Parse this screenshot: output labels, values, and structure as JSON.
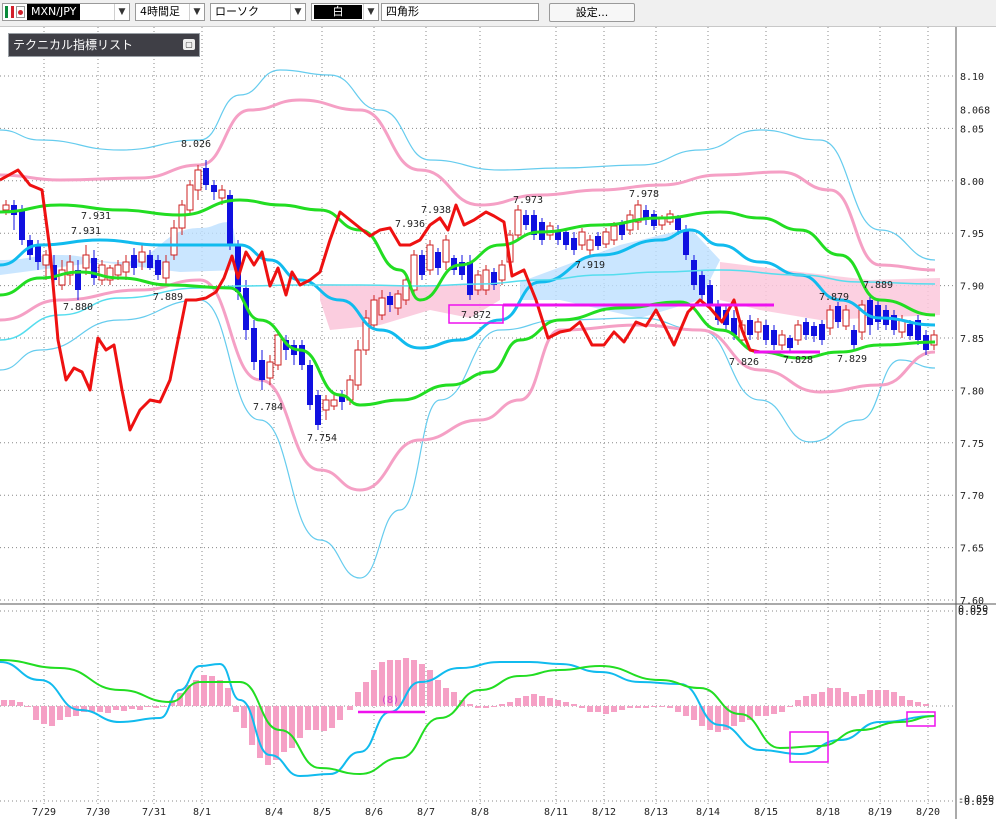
{
  "toolbar": {
    "pair": "MXN/JPY",
    "timeframe": "4時間足",
    "chart_style": "ローソク",
    "color": "白",
    "shape": "四角形",
    "settings": "設定..."
  },
  "indicator_panel": {
    "label": "テクニカル指標リスト"
  },
  "icons": {
    "dropdown": "chevron-down-icon",
    "panel": "window-toggle-icon",
    "flags": [
      "mexico-flag-icon",
      "japan-flag-icon"
    ]
  },
  "colors": {
    "bull": "#cc2222",
    "bear": "#1010e0",
    "rsi_line": "#ee1111",
    "ma_green": "#22dd22",
    "ma_cyan": "#11bbee",
    "bb_pink": "#f5a0c5",
    "bb_outer": "#66ccee",
    "marker": "#ee11ee",
    "cloud_pos": "#bde0ff",
    "cloud_neg": "#fbc8dc"
  },
  "chart_data": {
    "type": "candlestick",
    "ylim": [
      7.6,
      8.1
    ],
    "y_ticks": [
      "8.10",
      "8.068",
      "8.05",
      "8.00",
      "7.95",
      "7.90",
      "7.85",
      "7.80",
      "7.75",
      "7.70",
      "7.65",
      "7.60"
    ],
    "x_labels": [
      "7/29",
      "7/30",
      "7/31",
      "8/1",
      "8/4",
      "8/5",
      "8/6",
      "8/7",
      "8/8",
      "8/11",
      "8/12",
      "8/13",
      "8/14",
      "8/15",
      "8/18",
      "8/19",
      "8/20"
    ],
    "price_labels": [
      "8.026",
      "7.931",
      "7.931",
      "7.880",
      "7.889",
      "7.784",
      "7.754",
      "7.936",
      "7.938",
      "7.973",
      "7.872",
      "7.978",
      "7.919",
      "7.826",
      "7.828",
      "7.879",
      "7.829",
      "7.889"
    ],
    "oscillator": {
      "ylim": [
        -0.05,
        0.05
      ],
      "y_ticks": [
        "0.050",
        "0.025",
        "-0.025",
        "-0.050"
      ],
      "annotation": "(8)"
    }
  }
}
